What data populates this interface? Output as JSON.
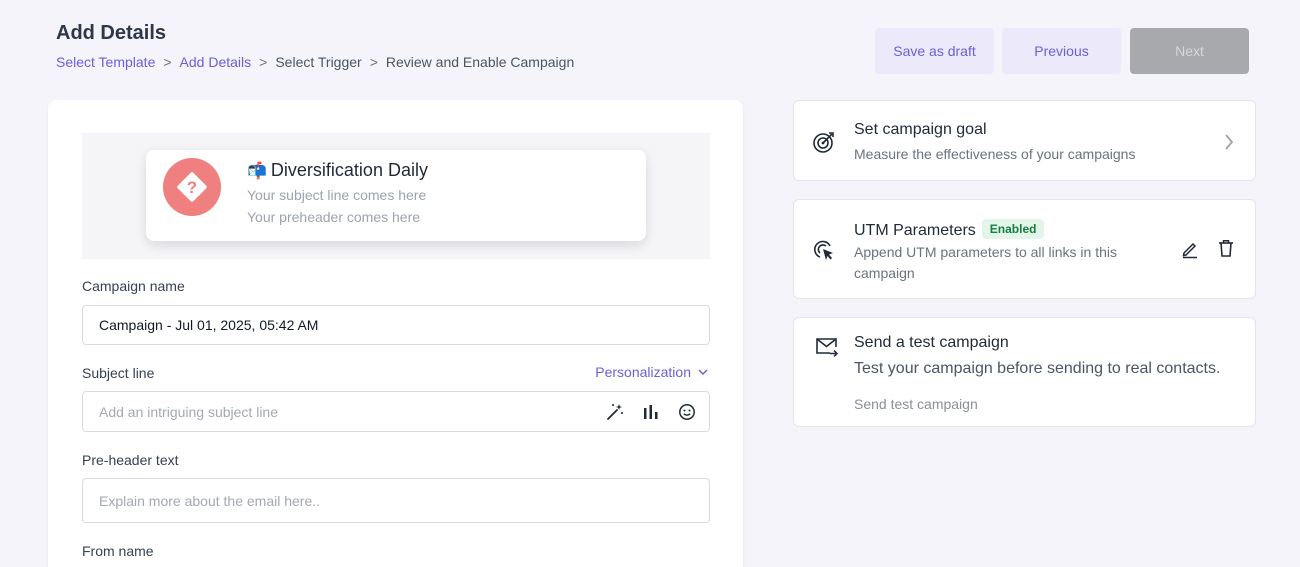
{
  "header": {
    "title": "Add Details",
    "breadcrumb": [
      "Select Template",
      "Add Details",
      "Select Trigger",
      "Review and Enable Campaign"
    ],
    "separator": ">"
  },
  "actions": {
    "save_draft": "Save as draft",
    "previous": "Previous",
    "next": "Next"
  },
  "preview": {
    "avatar_icon": "question-diamond-icon",
    "sender_emoji": "📬",
    "sender_name": "Diversification Daily",
    "subject": "Your subject line comes here",
    "preheader": "Your preheader comes here"
  },
  "form": {
    "campaign_name_label": "Campaign name",
    "campaign_name_value": "Campaign - Jul 01, 2025, 05:42 AM",
    "subject_label": "Subject line",
    "personalization": "Personalization",
    "subject_placeholder": "Add an intriguing subject line",
    "preheader_label": "Pre-header text",
    "preheader_placeholder": "Explain more about the email here..",
    "from_name_label": "From name"
  },
  "sidebar": {
    "goal": {
      "title": "Set campaign goal",
      "desc": "Measure the effectiveness of your campaigns"
    },
    "utm": {
      "title": "UTM Parameters",
      "badge": "Enabled",
      "desc_line1": "Append UTM parameters to all links in this",
      "desc_line2": "campaign"
    },
    "test": {
      "title": "Send a test campaign",
      "desc": "Test your campaign before sending to real contacts.",
      "link": "Send test campaign"
    }
  },
  "colors": {
    "accent": "#6b5fd6",
    "avatar": "#f08080",
    "badge_bg": "#e3f5ea",
    "badge_text": "#15803d"
  }
}
